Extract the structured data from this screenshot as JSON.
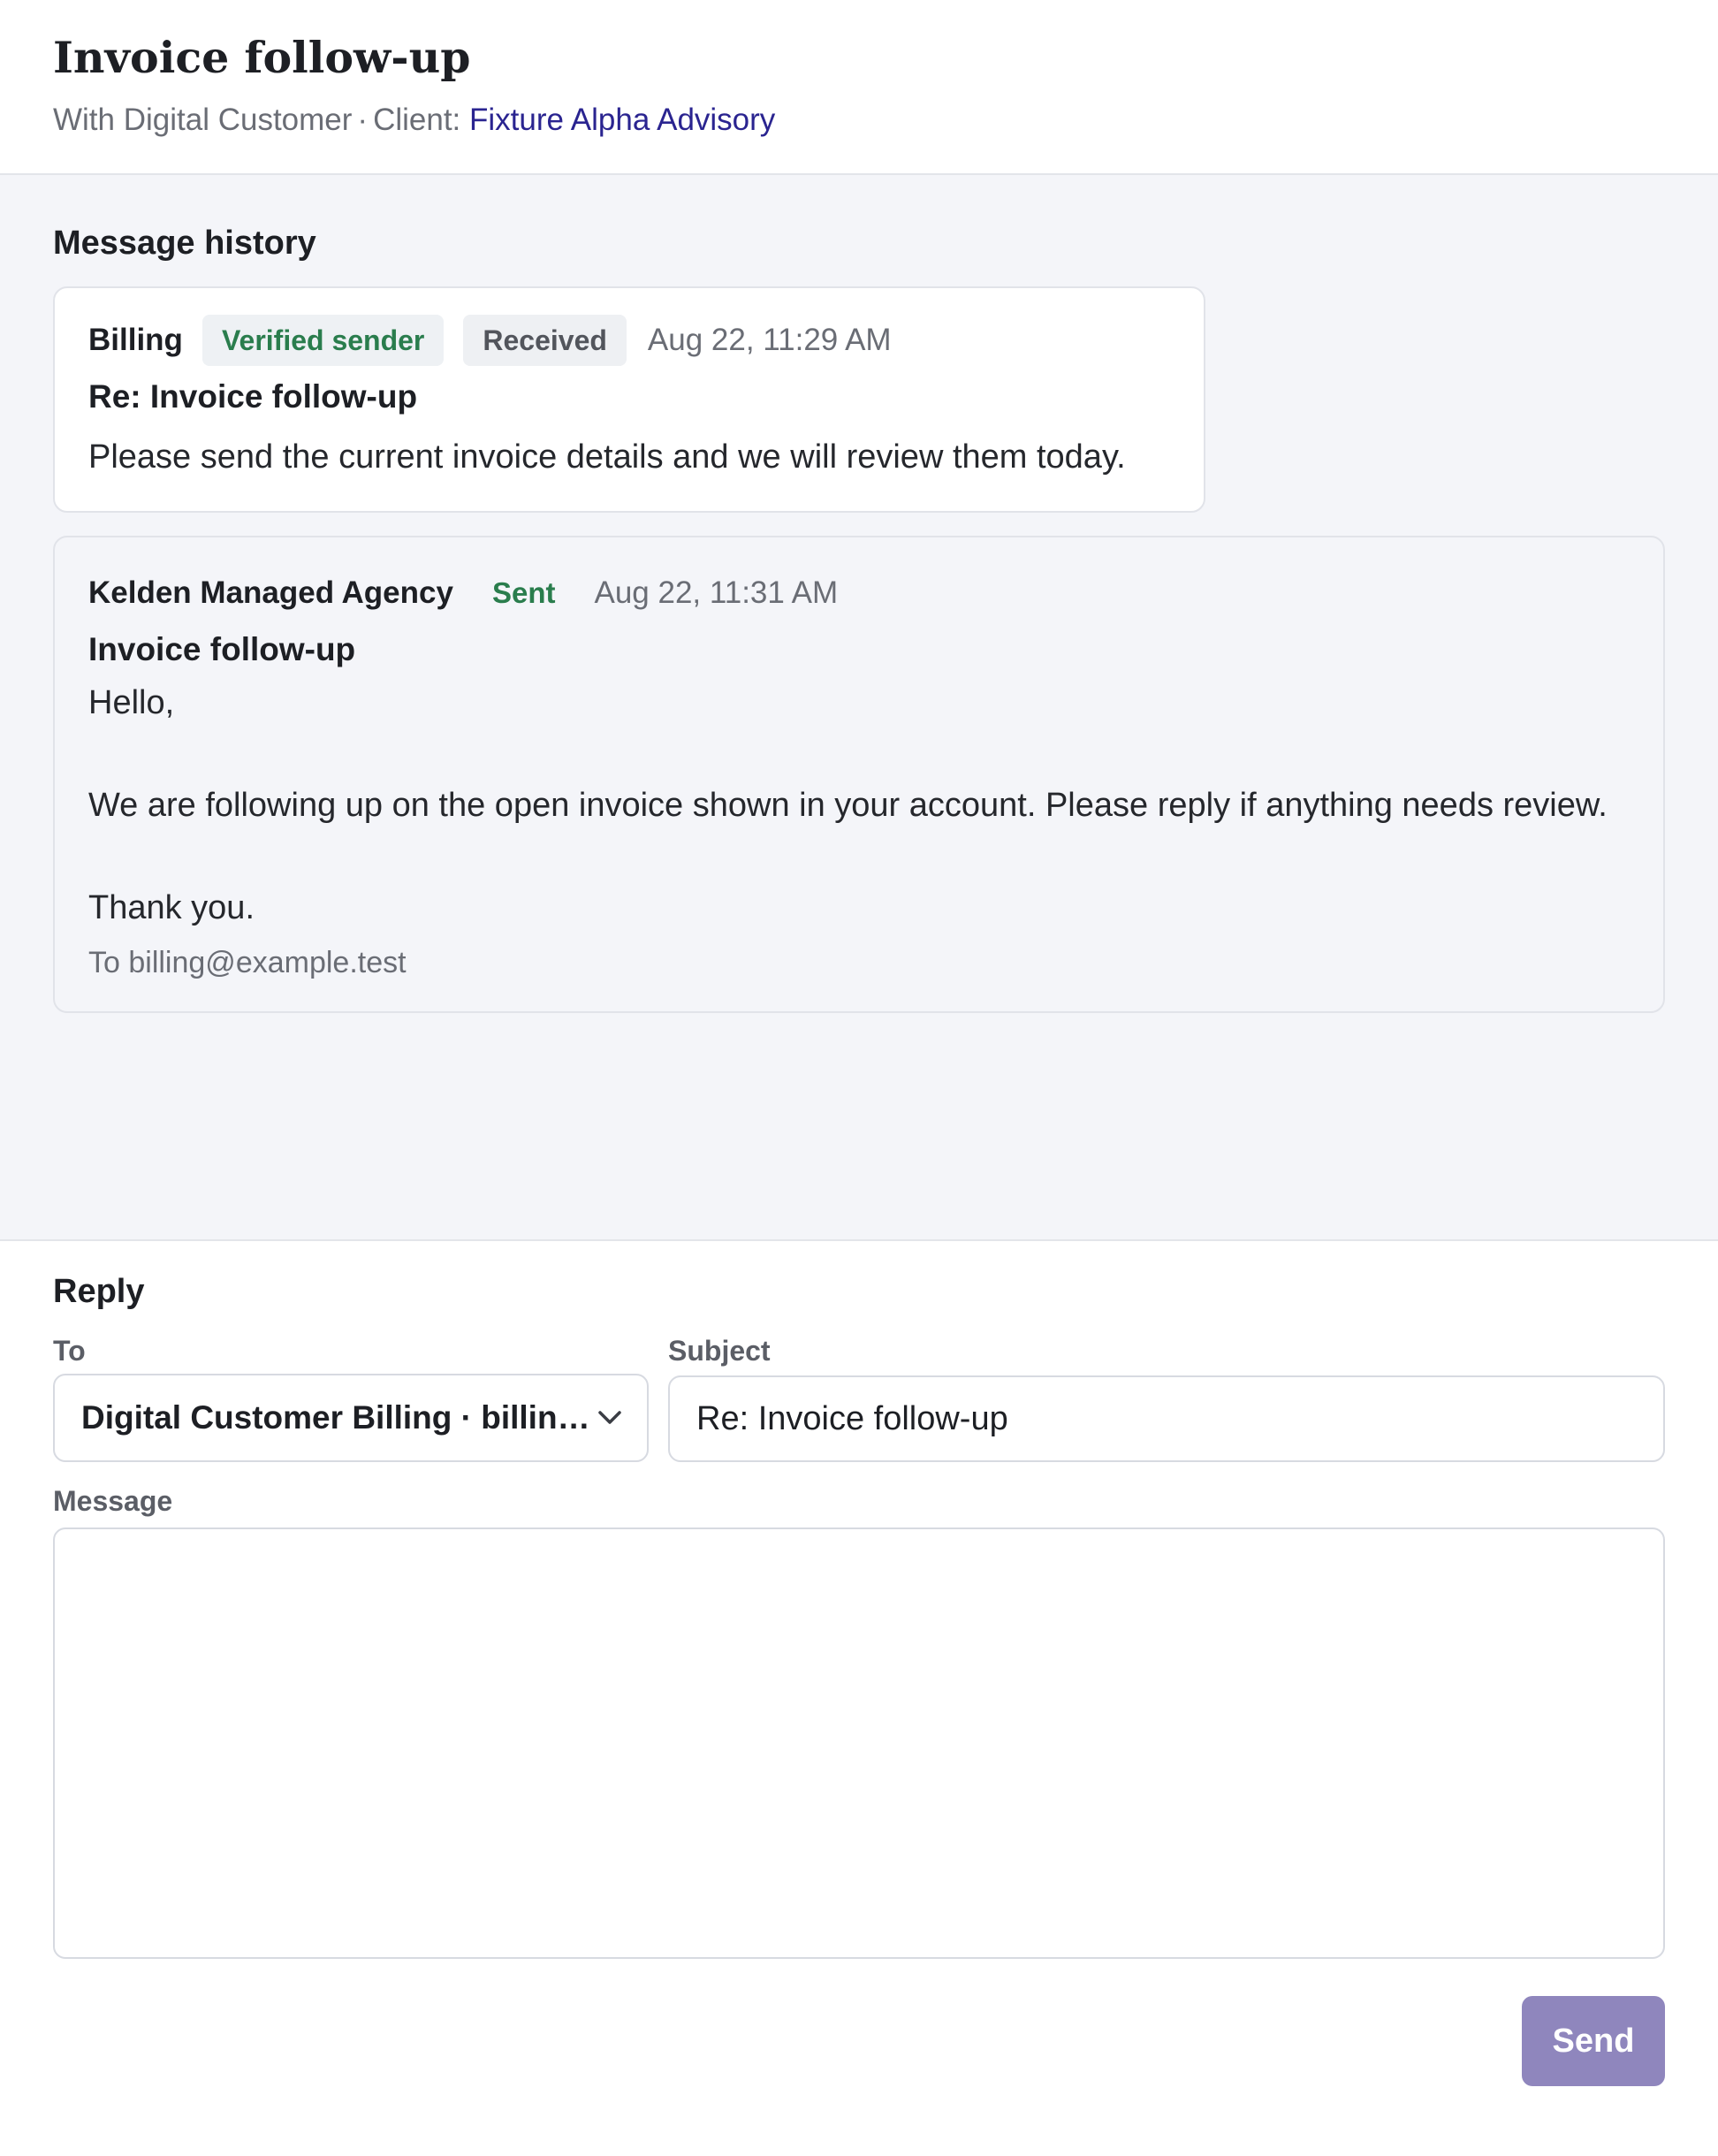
{
  "header": {
    "title": "Invoice follow-up",
    "with_text": "With Digital Customer",
    "separator": "·",
    "client_label": "Client:",
    "client_name": "Fixture Alpha Advisory"
  },
  "history": {
    "heading": "Message history",
    "messages": [
      {
        "sender": "Billing",
        "badge_verified": "Verified sender",
        "status": "Received",
        "timestamp": "Aug 22, 11:29 AM",
        "subject": "Re: Invoice follow-up",
        "body": "Please send the current invoice details and we will review them today."
      },
      {
        "sender": "Kelden Managed Agency",
        "status": "Sent",
        "timestamp": "Aug 22, 11:31 AM",
        "subject": "Invoice follow-up",
        "body": "Hello,\n\nWe are following up on the open invoice shown in your account. Please reply if anything needs review.\n\nThank you.",
        "to": "To billing@example.test"
      }
    ]
  },
  "reply": {
    "heading": "Reply",
    "to_label": "To",
    "to_value": "Digital Customer Billing · billing@example.test",
    "subject_label": "Subject",
    "subject_value": "Re: Invoice follow-up",
    "message_label": "Message",
    "message_value": "",
    "send_label": "Send"
  },
  "colors": {
    "accent": "#2a2490",
    "verified_green": "#2a7d4d",
    "send_button": "#8f86bd",
    "history_bg": "#f4f5f9"
  },
  "icons": {
    "to_dropdown": "chevron-down-icon"
  }
}
